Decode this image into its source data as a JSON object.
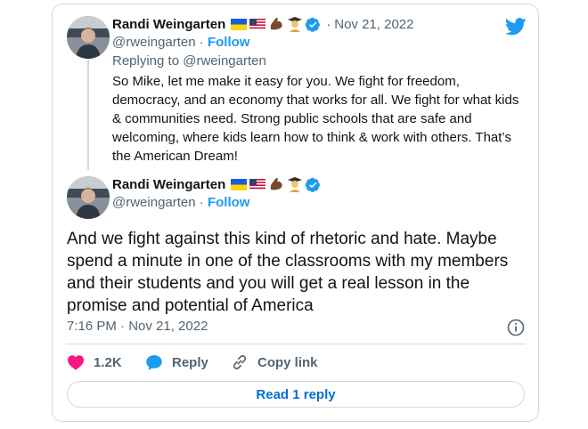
{
  "reply_tweet": {
    "author_name": "Randi Weingarten",
    "handle": "@rweingarten",
    "separator": "·",
    "follow_label": "Follow",
    "date": "Nov 21, 2022",
    "replying_to_prefix": "Replying to",
    "replying_to_handle": "@rweingarten",
    "text": "So Mike, let me make it easy for you. We fight for freedom, democracy, and an economy that works for all. We fight for what kids & communities need. Strong public schools that are safe and welcoming, where kids learn how to think & work with others. That’s the American Dream!"
  },
  "main_tweet": {
    "author_name": "Randi Weingarten",
    "handle": "@rweingarten",
    "separator": "·",
    "follow_label": "Follow",
    "text": "And we fight against this kind of rhetoric and hate. Maybe spend a minute in one of the classrooms with my members and their students and you will get a real lesson in the promise and potential of America",
    "timestamp": "7:16 PM · Nov 21, 2022"
  },
  "name_emojis": [
    "ukraine-flag",
    "us-flag",
    "flexed-biceps",
    "graduate"
  ],
  "actions": {
    "likes": "1.2K",
    "reply_label": "Reply",
    "copy_link_label": "Copy link"
  },
  "read_replies_label": "Read 1 reply",
  "colors": {
    "twitter_blue": "#1d9bf0",
    "like_red": "#f91880",
    "border": "#cfd9de",
    "muted": "#536471",
    "verified": "#1d9bf0"
  }
}
